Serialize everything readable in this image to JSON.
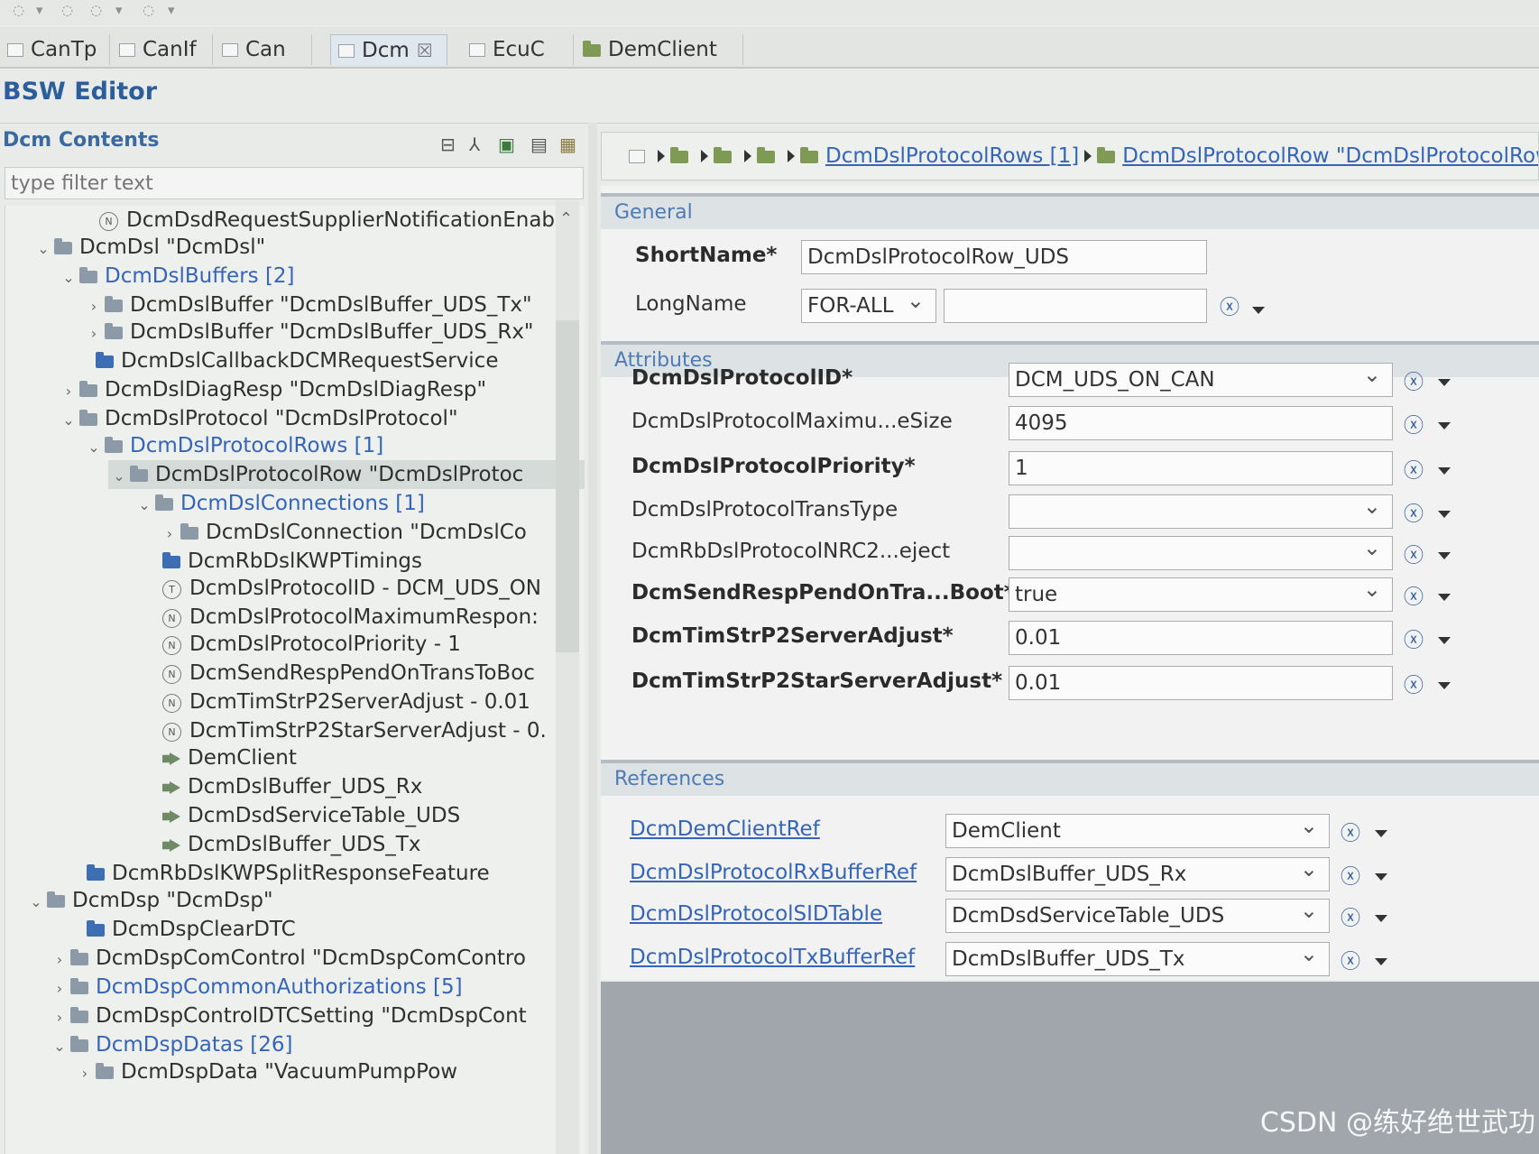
{
  "tabs": [
    {
      "label": "CanTp",
      "active": false,
      "icon": "document-icon"
    },
    {
      "label": "CanIf",
      "active": false,
      "icon": "document-icon"
    },
    {
      "label": "Can",
      "active": false,
      "icon": "document-icon"
    },
    {
      "label": "Dcm",
      "active": true,
      "icon": "document-icon",
      "close": "☒"
    },
    {
      "label": "EcuC",
      "active": false,
      "icon": "document-icon"
    },
    {
      "label": "DemClient",
      "active": false,
      "icon": "folder-icon"
    }
  ],
  "editor": {
    "title": "BSW Editor"
  },
  "left_panel": {
    "title": "Dcm Contents",
    "filter_placeholder": "type filter text",
    "tree": [
      {
        "label": "DcmDsdRequestSupplierNotificationEnabl",
        "icon": "param",
        "twisty": "",
        "link": false
      },
      {
        "label": "DcmDsl \"DcmDsl\"",
        "icon": "folder",
        "twisty": "v",
        "link": false
      },
      {
        "label": "DcmDslBuffers [2]",
        "icon": "folder",
        "twisty": "v",
        "link": true
      },
      {
        "label": "DcmDslBuffer \"DcmDslBuffer_UDS_Tx\"",
        "icon": "folder",
        "twisty": ">",
        "link": false
      },
      {
        "label": "DcmDslBuffer \"DcmDslBuffer_UDS_Rx\"",
        "icon": "folder",
        "twisty": ">",
        "link": false
      },
      {
        "label": "DcmDslCallbackDCMRequestService",
        "icon": "folder-blue",
        "twisty": "",
        "link": false
      },
      {
        "label": "DcmDslDiagResp \"DcmDslDiagResp\"",
        "icon": "folder",
        "twisty": ">",
        "link": false
      },
      {
        "label": "DcmDslProtocol \"DcmDslProtocol\"",
        "icon": "folder",
        "twisty": "v",
        "link": false
      },
      {
        "label": "DcmDslProtocolRows [1]",
        "icon": "folder",
        "twisty": "v",
        "link": true
      },
      {
        "label": "DcmDslProtocolRow \"DcmDslProtoc",
        "icon": "folder",
        "twisty": "v",
        "link": false,
        "selected": true
      },
      {
        "label": "DcmDslConnections [1]",
        "icon": "folder",
        "twisty": "v",
        "link": true
      },
      {
        "label": "DcmDslConnection \"DcmDslCo",
        "icon": "folder",
        "twisty": ">",
        "link": false
      },
      {
        "label": "DcmRbDslKWPTimings",
        "icon": "folder-blue",
        "twisty": "",
        "link": false
      },
      {
        "label": "DcmDslProtocolID - DCM_UDS_ON",
        "icon": "param-t",
        "twisty": "",
        "link": false
      },
      {
        "label": "DcmDslProtocolMaximumRespon:",
        "icon": "param",
        "twisty": "",
        "link": false
      },
      {
        "label": "DcmDslProtocolPriority - 1",
        "icon": "param",
        "twisty": "",
        "link": false
      },
      {
        "label": "DcmSendRespPendOnTransToBoc",
        "icon": "param",
        "twisty": "",
        "link": false
      },
      {
        "label": "DcmTimStrP2ServerAdjust - 0.01",
        "icon": "param",
        "twisty": "",
        "link": false
      },
      {
        "label": "DcmTimStrP2StarServerAdjust - 0.",
        "icon": "param",
        "twisty": "",
        "link": false
      },
      {
        "label": "DemClient",
        "icon": "ref",
        "twisty": "",
        "link": false
      },
      {
        "label": "DcmDslBuffer_UDS_Rx",
        "icon": "ref",
        "twisty": "",
        "link": false
      },
      {
        "label": "DcmDsdServiceTable_UDS",
        "icon": "ref",
        "twisty": "",
        "link": false
      },
      {
        "label": "DcmDslBuffer_UDS_Tx",
        "icon": "ref",
        "twisty": "",
        "link": false
      },
      {
        "label": "DcmRbDslKWPSplitResponseFeature",
        "icon": "folder-blue",
        "twisty": "",
        "link": false
      },
      {
        "label": "DcmDsp \"DcmDsp\"",
        "icon": "folder",
        "twisty": "v",
        "link": false
      },
      {
        "label": "DcmDspClearDTC",
        "icon": "folder-blue",
        "twisty": "",
        "link": false
      },
      {
        "label": "DcmDspComControl \"DcmDspComContro",
        "icon": "folder",
        "twisty": ">",
        "link": false
      },
      {
        "label": "DcmDspCommonAuthorizations [5]",
        "icon": "folder",
        "twisty": ">",
        "link": true
      },
      {
        "label": "DcmDspControlDTCSetting \"DcmDspCont",
        "icon": "folder",
        "twisty": ">",
        "link": false
      },
      {
        "label": "DcmDspDatas [26]",
        "icon": "folder",
        "twisty": "v",
        "link": true
      },
      {
        "label": "DcmDspData \"VacuumPumpPow",
        "icon": "folder",
        "twisty": ">",
        "link": false
      }
    ]
  },
  "breadcrumb": {
    "items": [
      "DcmDslProtocolRows [1]",
      "DcmDslProtocolRow \"DcmDslProtocolRow"
    ]
  },
  "general": {
    "title": "General",
    "shortname_label": "ShortName*",
    "shortname_value": "DcmDslProtocolRow_UDS",
    "longname_label": "LongName",
    "longname_lang": "FOR-ALL",
    "longname_value": ""
  },
  "attributes": {
    "title": "Attributes",
    "rows": [
      {
        "label": "DcmDslProtocolID*",
        "value": "DCM_UDS_ON_CAN",
        "bold": true,
        "combo": true
      },
      {
        "label": "DcmDslProtocolMaximu...eSize",
        "value": "4095",
        "bold": false,
        "combo": false
      },
      {
        "label": "DcmDslProtocolPriority*",
        "value": "1",
        "bold": true,
        "combo": false
      },
      {
        "label": "DcmDslProtocolTransType",
        "value": "",
        "bold": false,
        "combo": true
      },
      {
        "label": "DcmRbDslProtocolNRC2...eject",
        "value": "",
        "bold": false,
        "combo": true
      },
      {
        "label": "DcmSendRespPendOnTra...Boot*",
        "value": "true",
        "bold": true,
        "combo": true
      },
      {
        "label": "DcmTimStrP2ServerAdjust*",
        "value": "0.01",
        "bold": true,
        "combo": false
      },
      {
        "label": "DcmTimStrP2StarServerAdjust*",
        "value": "0.01",
        "bold": true,
        "combo": false
      }
    ]
  },
  "references": {
    "title": "References",
    "rows": [
      {
        "label": "DcmDemClientRef",
        "value": "DemClient"
      },
      {
        "label": "DcmDslProtocolRxBufferRef",
        "value": "DcmDslBuffer_UDS_Rx"
      },
      {
        "label": "DcmDslProtocolSIDTable",
        "value": "DcmDsdServiceTable_UDS"
      },
      {
        "label": "DcmDslProtocolTxBufferRef",
        "value": "DcmDslBuffer_UDS_Tx"
      }
    ]
  },
  "watermark": "CSDN @练好绝世武功",
  "colors": {
    "accent": "#2c5e9c",
    "link": "#3565b8",
    "section_head": "#4d7bb5"
  }
}
